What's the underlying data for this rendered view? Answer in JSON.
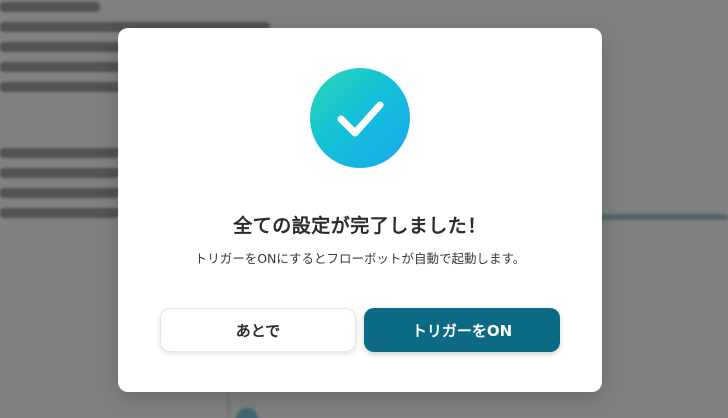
{
  "modal": {
    "title": "全ての設定が完了しました！",
    "message": "トリガーをONにするとフローボットが自動で起動します。",
    "secondary_button_label": "あとで",
    "primary_button_label": "トリガーをON",
    "icon": "check-icon"
  },
  "colors": {
    "primary_button": "#0d6a84",
    "check_gradient_start": "#2bd4b4",
    "check_gradient_end": "#1aa6ee",
    "overlay": "rgba(0,0,0,0.48)"
  }
}
